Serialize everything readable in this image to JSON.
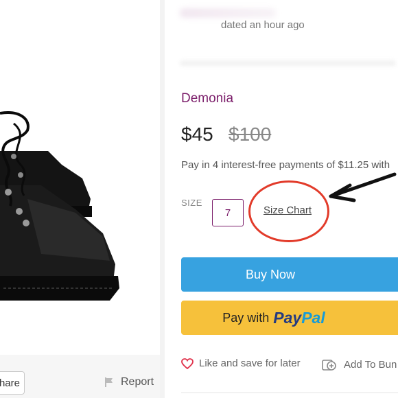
{
  "listing": {
    "updated_text": "dated an hour ago",
    "brand": "Demonia",
    "price": "$45",
    "original_price": "$100",
    "installments": "Pay in 4 interest-free payments of $11.25 with"
  },
  "size": {
    "label": "SIZE",
    "selected": "7",
    "chart_link": "Size Chart"
  },
  "actions": {
    "buy_now": "Buy Now",
    "pay_with": "Pay with",
    "paypal_pay": "Pay",
    "paypal_pal": "Pal",
    "like": "Like and save for later",
    "bundle": "Add To Bun"
  },
  "left": {
    "share": "hare",
    "report": "Report"
  },
  "colors": {
    "brand": "#7b1d6a",
    "buy_now": "#37a2e0",
    "paypal_button": "#f6c13b",
    "annotation_red": "#e23b2a"
  },
  "icons": {
    "like": "heart-icon",
    "bundle": "bundle-add-icon",
    "report": "flag-icon",
    "annotation": "arrow-icon"
  }
}
